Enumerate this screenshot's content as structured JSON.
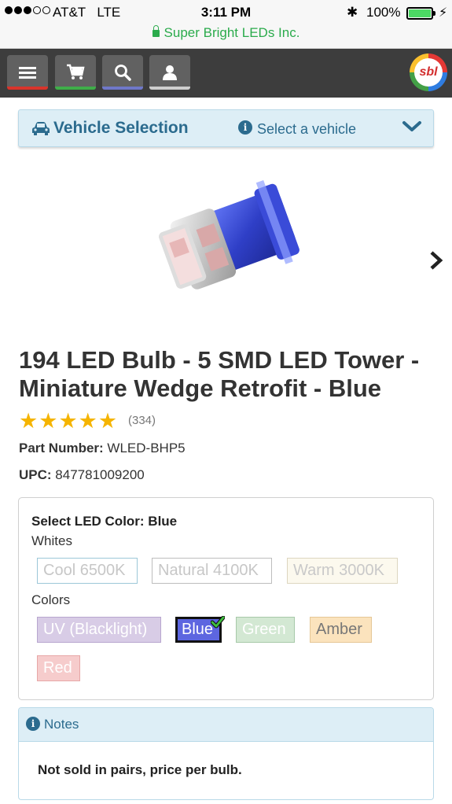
{
  "status_bar": {
    "carrier": "AT&T",
    "network": "LTE",
    "time": "3:11 PM",
    "battery": "100%",
    "battery_level": 1.0,
    "url": "Super Bright LEDs Inc."
  },
  "navbar": {
    "icons": [
      "menu-icon",
      "cart-icon",
      "search-icon",
      "user-icon"
    ],
    "logo_text": "sbl"
  },
  "vehicle": {
    "title": "Vehicle Selection",
    "prompt": "Select a vehicle"
  },
  "product": {
    "title": "194 LED Bulb - 5 SMD LED Tower - Miniature Wedge Retrofit - Blue",
    "rating": 5,
    "review_count": "(334)",
    "part_label": "Part Number:",
    "part_value": "WLED-BHP5",
    "upc_label": "UPC:",
    "upc_value": "847781009200"
  },
  "color_selector": {
    "title": "Select LED Color: Blue",
    "whites_label": "Whites",
    "whites": [
      "Cool 6500K",
      "Natural 4100K",
      "Warm 3000K"
    ],
    "colors_label": "Colors",
    "colors": [
      "UV (Blacklight)",
      "Blue",
      "Green",
      "Amber",
      "Red"
    ],
    "selected": "Blue"
  },
  "notes": {
    "title": "Notes",
    "body": "Not sold in pairs, price per bulb."
  },
  "colors": {
    "accent_blue": "#2b6b8e",
    "panel_bg": "#ddeef6",
    "star": "#f5b400",
    "ssl_green": "#2bab4c"
  }
}
